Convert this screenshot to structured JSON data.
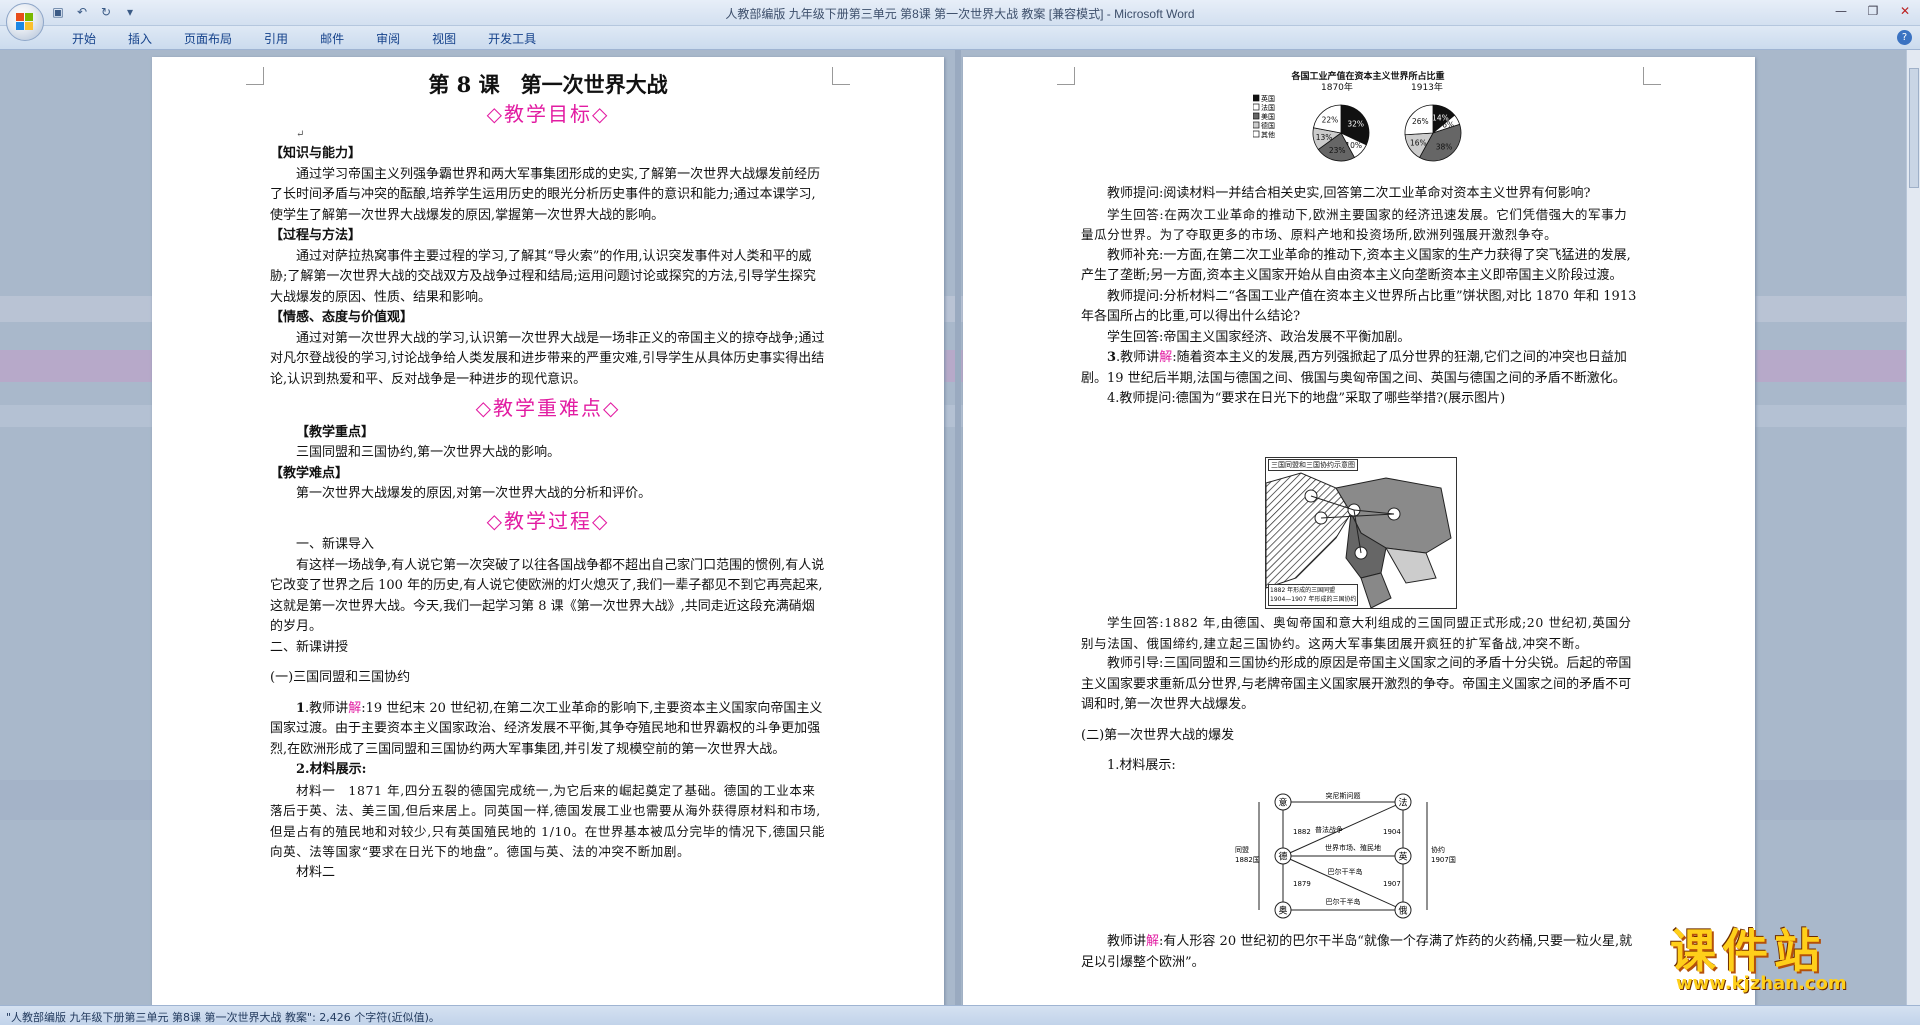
{
  "window": {
    "title": "人教部编版  九年级下册第三单元   第8课   第一次世界大战   教案 [兼容模式] - Microsoft Word"
  },
  "ribbon": {
    "tabs": [
      "开始",
      "插入",
      "页面布局",
      "引用",
      "邮件",
      "审阅",
      "视图",
      "开发工具"
    ]
  },
  "status": {
    "text": "\"人教部编版  九年级下册第三单元   第8课   第一次世界大战   教案\": 2,426 个字符(近似值)。"
  },
  "watermark": {
    "title": "课件站",
    "url": "www.kjzhan.com"
  },
  "page_left": {
    "title": "第 8 课　第一次世界大战",
    "h_goals": "◇教学目标◇",
    "s1_head": "【知识与能力】",
    "s1_body": "通过学习帝国主义列强争霸世界和两大军事集团形成的史实,了解第一次世界大战爆发前经历了长时间矛盾与冲突的酝酿,培养学生运用历史的眼光分析历史事件的意识和能力;通过本课学习,使学生了解第一次世界大战爆发的原因,掌握第一次世界大战的影响。",
    "s2_head": "【过程与方法】",
    "s2_body": "通过对萨拉热窝事件主要过程的学习,了解其“导火索”的作用,认识突发事件对人类和平的威胁;了解第一次世界大战的交战双方及战争过程和结局;运用问题讨论或探究的方法,引导学生探究大战爆发的原因、性质、结果和影响。",
    "s3_head": "【情感、态度与价值观】",
    "s3_body": "通过对第一次世界大战的学习,认识第一次世界大战是一场非正义的帝国主义的掠夺战争;通过对凡尔登战役的学习,讨论战争给人类发展和进步带来的严重灾难,引导学生从具体历史事实得出结论,认识到热爱和平、反对战争是一种进步的现代意识。",
    "h_key": "◇教学重难点◇",
    "key_head": "【教学重点】",
    "key_body": "三国同盟和三国协约,第一次世界大战的影响。",
    "diff_head": "【教学难点】",
    "diff_body": "第一次世界大战爆发的原因,对第一次世界大战的分析和评价。",
    "h_process": "◇教学过程◇",
    "p1_head": "一、新课导入",
    "p1_body": "有这样一场战争,有人说它第一次突破了以往各国战争都不超出自己家门口范围的惯例,有人说它改变了世界之后 100 年的历史,有人说它使欧洲的灯火熄灭了,我们一辈子都见不到它再亮起来,这就是第一次世界大战。今天,我们一起学习第 8 课《第一次世界大战》,共同走近这段充满硝烟的岁月。",
    "p2_head": "二、新课讲授",
    "p3_head": "(一)三国同盟和三国协约",
    "p4_num": "1",
    "p4_pre": ".教师讲",
    "p4_mark": "解",
    "p4_body": ":19 世纪末 20 世纪初,在第二次工业革命的影响下,主要资本主义国家向帝国主义国家过渡。由于主要资本主义国家政治、经济发展不平衡,其争夺殖民地和世界霸权的斗争更加强烈,在欧洲形成了三国同盟和三国协约两大军事集团,并引发了规模空前的第一次世界大战。",
    "p5_head": "2.材料展示:",
    "p6": "材料一　1871 年,四分五裂的德国完成统一,为它后来的崛起奠定了基础。德国的工业本来落后于英、法、美三国,但后来居上。同英国一样,德国发展工业也需要从海外获得原材料和市场,但是占有的殖民地和对较少,只有英国殖民地的 1/10。在世界基本被瓜分完毕的情况下,德国只能向英、法等国家“要求在日光下的地盘”。德国与英、法的冲突不断加剧。",
    "p7": "材料二"
  },
  "page_right": {
    "chart_title": "各国工业产值在资本主义世界所占比重",
    "year_left": "1870年",
    "year_right": "1913年",
    "legend": [
      "英国",
      "法国",
      "美国",
      "德国",
      "其他"
    ],
    "pie1_labels": [
      "32%",
      "10%",
      "23%",
      "13%",
      "22%"
    ],
    "pie2_labels": [
      "14%",
      "6%",
      "38%",
      "16%",
      "26%"
    ],
    "q1": "教师提问:阅读材料一并结合相关史实,回答第二次工业革命对资本主义世界有何影响?",
    "a1": "学生回答:在两次工业革命的推动下,欧洲主要国家的经济迅速发展。它们凭借强大的军事力量瓜分世界。为了夺取更多的市场、原料产地和投资场所,欧洲列强展开激烈争夺。",
    "s1": "教师补充:一方面,在第二次工业革命的推动下,资本主义国家的生产力获得了突飞猛进的发展,产生了垄断;另一方面,资本主义国家开始从自由资本主义向垄断资本主义即帝国主义阶段过渡。",
    "q2": "教师提问:分析材料二“各国工业产值在资本主义世界所占比重”饼状图,对比 1870 年和 1913 年各国所占的比重,可以得出什么结论?",
    "a2": "学生回答:帝国主义国家经济、政治发展不平衡加剧。",
    "t3_num": "3",
    "t3_pre": ".教师讲",
    "t3_mark": "解",
    "t3_body": ":随着资本主义的发展,西方列强掀起了瓜分世界的狂潮,它们之间的冲突也日益加剧。19 世纪后半期,法国与德国之间、俄国与奥匈帝国之间、英国与德国之间的矛盾不断激化。",
    "t4": "4.教师提问:德国为“要求在日光下的地盘”采取了哪些举措?(展示图片)",
    "map_title": "三国同盟和三国协约示意图",
    "map_legend": [
      "1882 年形成的三国同盟",
      "1904—1907 年形成的三国协约"
    ],
    "a4": "学生回答:1882 年,由德国、奥匈帝国和意大利组成的三国同盟正式形成;20 世纪初,英国分别与法国、俄国缔约,建立起三国协约。这两大军事集团展开疯狂的扩军备战,冲突不断。",
    "g1": "教师引导:三国同盟和三国协约形成的原因是帝国主义国家之间的矛盾十分尖锐。后起的帝国主义国家要求重新瓜分世界,与老牌帝国主义国家展开激烈的争夺。帝国主义国家之间的矛盾不可调和时,第一次世界大战爆发。",
    "sec2": "(二)第一次世界大战的爆发",
    "m1": "1.材料展示:",
    "diagram": {
      "nodes": [
        "意",
        "法",
        "德",
        "英",
        "奥",
        "俄"
      ],
      "top_label": "突尼斯问题",
      "year1": "1882",
      "year2": "1904",
      "year3": "1879",
      "year4": "1907",
      "left_label": "同盟1882国",
      "right_label": "协约1907国",
      "war1": "普法战争",
      "war2": "世界市场、殖民地",
      "war3": "巴尔干半岛",
      "war4": "巴尔干半岛"
    },
    "t5_pre": "教师讲",
    "t5_mark": "解",
    "t5_body": ":有人形容 20 世纪初的巴尔干半岛“就像一个存满了炸药的火药桶,只要一粒火星,就足以引爆整个欧洲”。"
  },
  "colors": {
    "heading_pink": "#e21ca2",
    "watermark": "#ffcf1a"
  }
}
